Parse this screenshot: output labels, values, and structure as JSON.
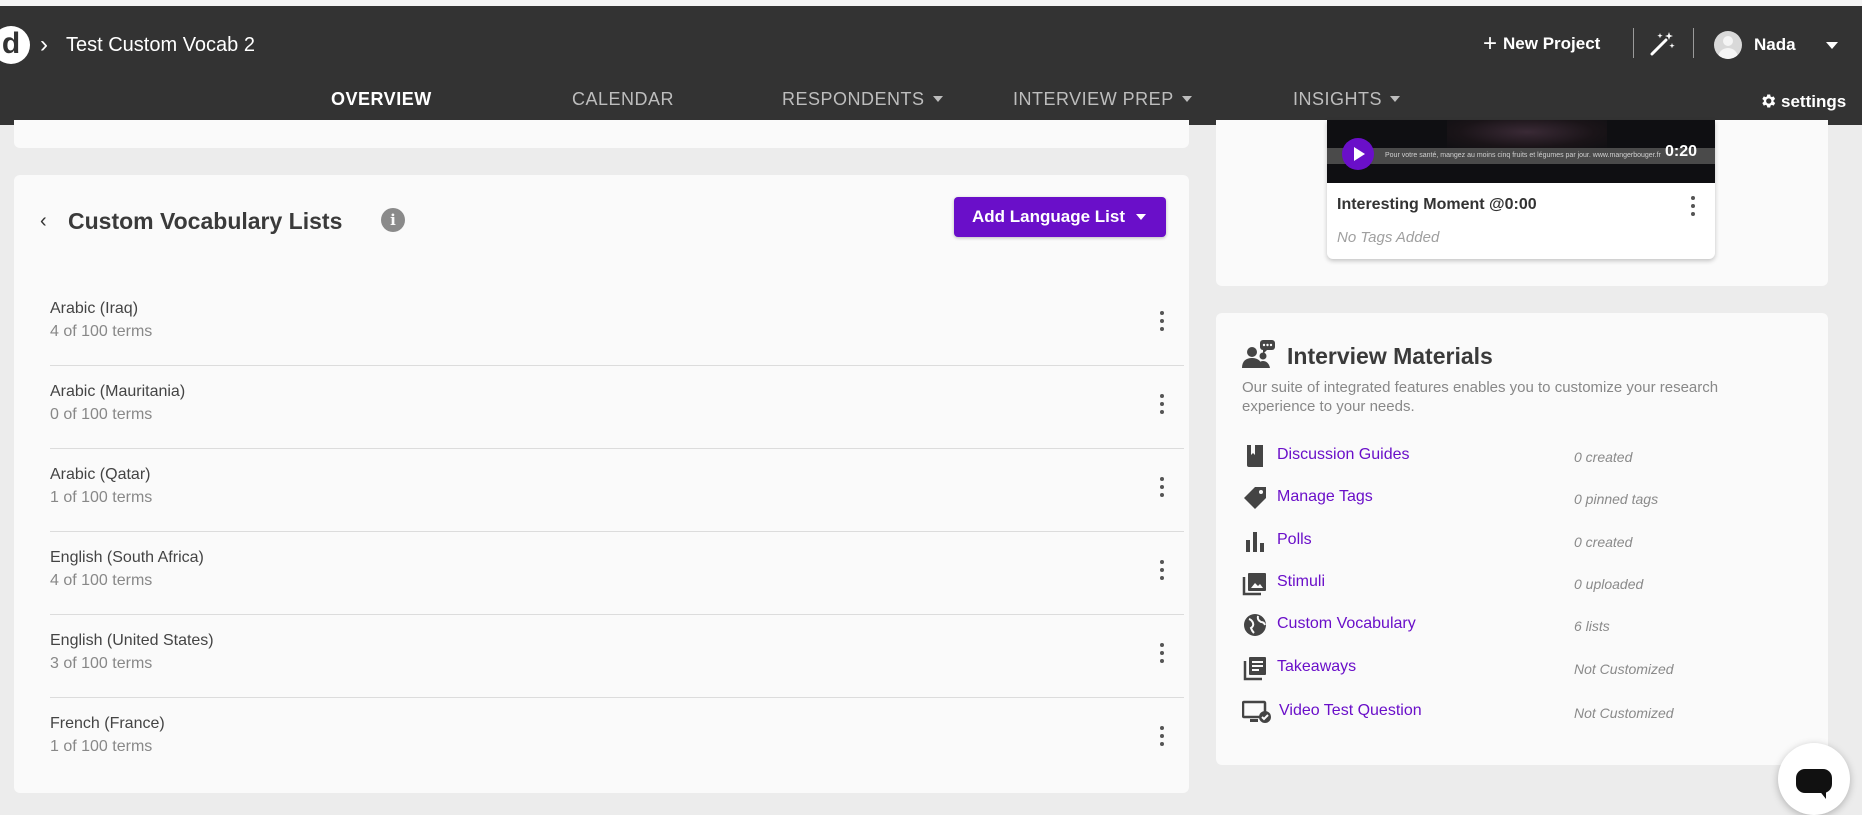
{
  "header": {
    "logo_text": "d",
    "project_title": "Test Custom Vocab 2",
    "new_project_label": "New Project",
    "user_name": "Nada"
  },
  "nav": {
    "tabs": [
      {
        "label": "OVERVIEW",
        "active": true
      },
      {
        "label": "CALENDAR"
      },
      {
        "label": "RESPONDENTS"
      },
      {
        "label": "INTERVIEW PREP"
      },
      {
        "label": "INSIGHTS"
      }
    ],
    "settings_label": "settings"
  },
  "vocab": {
    "title": "Custom Vocabulary Lists",
    "add_button_label": "Add Language List",
    "lists": [
      {
        "name": "Arabic (Iraq)",
        "count": "4 of 100 terms"
      },
      {
        "name": "Arabic (Mauritania)",
        "count": "0 of 100 terms"
      },
      {
        "name": "Arabic (Qatar)",
        "count": "1 of 100 terms"
      },
      {
        "name": "English (South Africa)",
        "count": "4 of 100 terms"
      },
      {
        "name": "English (United States)",
        "count": "3 of 100 terms"
      },
      {
        "name": "French (France)",
        "count": "1 of 100 terms"
      }
    ]
  },
  "moment": {
    "video_caption": "Pour votre santé, mangez au moins cinq fruits et légumes par jour. www.mangerbouger.fr",
    "duration": "0:20",
    "title": "Interesting Moment @0:00",
    "tags_placeholder": "No Tags Added"
  },
  "materials": {
    "title": "Interview Materials",
    "description": "Our suite of integrated features enables you to customize your research experience to your needs.",
    "items": [
      {
        "icon": "book-icon",
        "label": "Discussion Guides",
        "status": "0 created"
      },
      {
        "icon": "tag-icon",
        "label": "Manage Tags",
        "status": "0 pinned tags"
      },
      {
        "icon": "bar-chart-icon",
        "label": "Polls",
        "status": "0 created"
      },
      {
        "icon": "image-icon",
        "label": "Stimuli",
        "status": "0 uploaded"
      },
      {
        "icon": "globe-icon",
        "label": "Custom Vocabulary",
        "status": "6 lists"
      },
      {
        "icon": "document-list-icon",
        "label": "Takeaways",
        "status": "Not Customized"
      },
      {
        "icon": "monitor-check-icon",
        "label": "Video Test Question",
        "status": "Not Customized"
      }
    ]
  },
  "colors": {
    "header_bg": "#333333",
    "accent_purple": "#6a0fc9",
    "active_tab_underline": "#e3668f",
    "page_bg": "#ececec",
    "card_bg": "#fafafa"
  }
}
